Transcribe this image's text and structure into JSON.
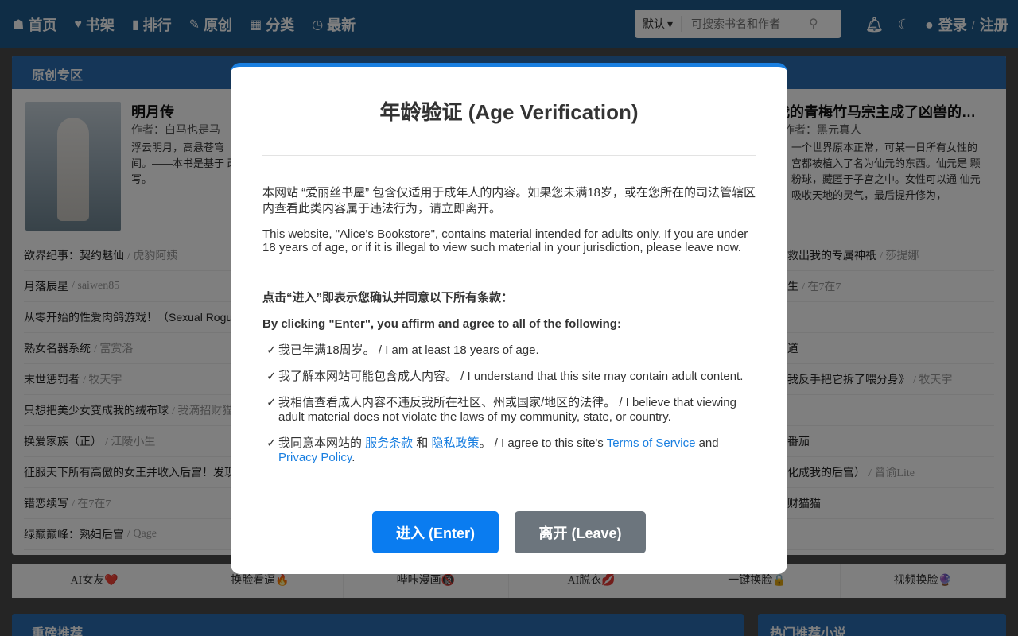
{
  "nav": {
    "links": [
      {
        "icon": "home-icon",
        "glyph": "☗",
        "label": "首页"
      },
      {
        "icon": "heart-icon",
        "glyph": "♥",
        "label": "书架"
      },
      {
        "icon": "bar-chart-icon",
        "glyph": "▮",
        "label": "排行"
      },
      {
        "icon": "feather-icon",
        "glyph": "✎",
        "label": "原创"
      },
      {
        "icon": "grid-icon",
        "glyph": "▦",
        "label": "分类"
      },
      {
        "icon": "clock-icon",
        "glyph": "◷",
        "label": "最新"
      }
    ],
    "search": {
      "sort_label": "默认",
      "placeholder": "可搜索书名和作者"
    },
    "login_label": "登录",
    "register_label": "注册"
  },
  "panel": {
    "title": "原创专区",
    "featured_left": {
      "title": "明月传",
      "author": "作者：白马也是马",
      "desc": "浮云明月，高悬苍穹 间。——本书是基于 改写。"
    },
    "featured_right": {
      "title": "我的青梅竹马宗主成了凶兽的…",
      "author": "作者：黑元真人",
      "desc": "一个世界原本正常，可某一日所有女性的 宫都被植入了名为仙元的东西。仙元是 颗粉球，藏匿于子宫之中。女性可以通 仙元吸收天地的灵气，最后提升修为，"
    },
    "list_left": [
      {
        "title": "欲界纪事：契约魅仙",
        "author": "/ 虎豹阿姨"
      },
      {
        "title": "月落辰星",
        "author": "/ saiwen85"
      },
      {
        "title": "从零开始的性爱肉鸽游戏！（Sexual Rogue",
        "author": ""
      },
      {
        "title": "熟女名器系统",
        "author": "/ 富赏洛"
      },
      {
        "title": "末世惩罚者",
        "author": "/ 牧天宇"
      },
      {
        "title": "只想把美少女变成我的绒布球",
        "author": "/ 我滴招财猫"
      },
      {
        "title": "换爱家族（正）",
        "author": "/ 江陵小生"
      },
      {
        "title": "征服天下所有高傲的女王并收入后宫！发现",
        "author": ""
      },
      {
        "title": "错恋续写",
        "author": "/ 在7在7"
      },
      {
        "title": "绿巅巅峰：熟妇后宫",
        "author": "/ Qage"
      }
    ],
    "list_right": [
      {
        "title": "救出我的专属神祇",
        "author": "/ 莎提娜"
      },
      {
        "title": "生",
        "author": "/ 在7在7"
      },
      {
        "title": "",
        "author": ""
      },
      {
        "title": "道",
        "author": ""
      },
      {
        "title": "我反手把它拆了喂分身》",
        "author": "/ 牧天宇"
      },
      {
        "title": "",
        "author": ""
      },
      {
        "title": "番茄",
        "author": ""
      },
      {
        "title": "化成我的后宫）",
        "author": "/ 曾谕Lite"
      },
      {
        "title": "财猫猫",
        "author": ""
      },
      {
        "title": "",
        "author": ""
      }
    ]
  },
  "ads": [
    "AI女友❤️",
    "换脸看逼🔥",
    "哔咔漫画🔞",
    "AI脱衣💋",
    "一键换脸🔒",
    "视频换脸🔮"
  ],
  "bottom": {
    "left_title": "重磅推荐",
    "right_title": "热门推荐小说"
  },
  "modal": {
    "title": "年龄验证 (Age Verification)",
    "para_cn": "本网站 “爱丽丝书屋” 包含仅适用于成年人的内容。如果您未满18岁，或在您所在的司法管辖区内查看此类内容属于违法行为，请立即离开。",
    "para_en": "This website, \"Alice's Bookstore\", contains material intended for adults only. If you are under 18 years of age, or if it is illegal to view such material in your jurisdiction, please leave now.",
    "terms_cn": "点击“进入”即表示您确认并同意以下所有条款：",
    "terms_en": "By clicking \"Enter\", you affirm and agree to all of the following:",
    "check_glyph": "✓",
    "items": [
      "我已年满18周岁。 / I am at least 18 years of age.",
      "我了解本网站可能包含成人内容。 / I understand that this site may contain adult content.",
      "我相信查看成人内容不违反我所在社区、州或国家/地区的法律。 / I believe that viewing adult material does not violate the laws of my community, state, or country."
    ],
    "agree": {
      "prefix": "我同意本网站的 ",
      "tos_cn": "服务条款",
      "and_cn": " 和 ",
      "privacy_cn": "隐私政策",
      "mid": "。 / I agree to this site's ",
      "tos_en": "Terms of Service",
      "and_en": " and",
      "privacy_en": "Privacy Policy",
      "end": "."
    },
    "enter_label": "进入 (Enter)",
    "leave_label": "离开 (Leave)"
  }
}
